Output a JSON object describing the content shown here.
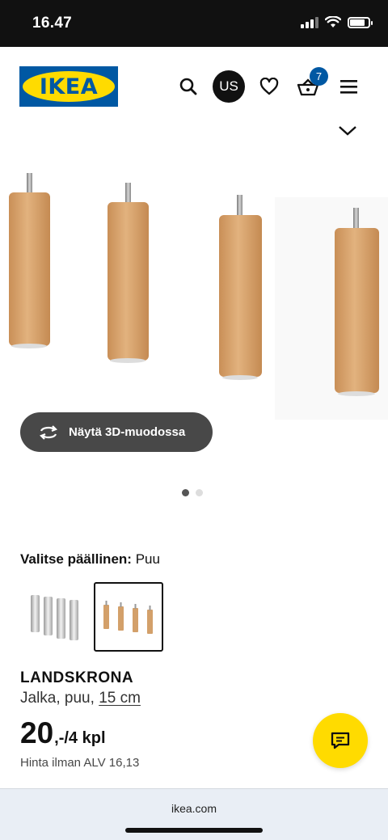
{
  "status": {
    "time": "16.47"
  },
  "header": {
    "logo_text": "IKEA",
    "account_initials": "US",
    "cart_count": "7"
  },
  "gallery": {
    "view_3d_label": "Näytä 3D-muodossa",
    "active_dot": 1,
    "dot_count": 2
  },
  "variant": {
    "label": "Valitse päällinen:",
    "value": "Puu",
    "options": [
      {
        "name": "Metal",
        "color": "#c8c8c8",
        "selected": false
      },
      {
        "name": "Puu",
        "color": "#d7a46c",
        "selected": true
      }
    ]
  },
  "product": {
    "name": "LANDSKRONA",
    "type": "Jalka, puu,",
    "size": "15 cm",
    "price_main": "20",
    "price_suffix": ",-/4 kpl",
    "vat_note": "Hinta ilman ALV 16,13"
  },
  "browser": {
    "url": "ikea.com"
  },
  "colors": {
    "brand_blue": "#0058a3",
    "brand_yellow": "#ffdb00",
    "wood": "#d7a46c"
  }
}
